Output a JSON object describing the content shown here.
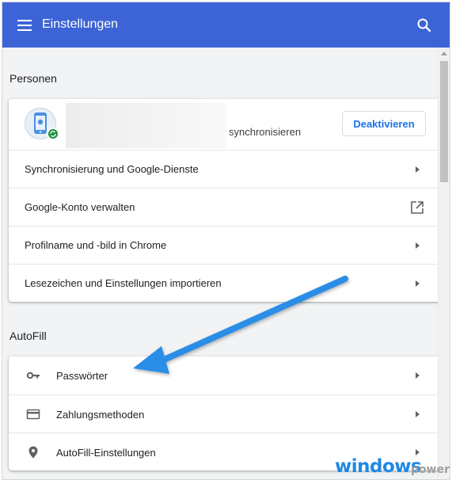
{
  "header": {
    "title": "Einstellungen",
    "menu_icon": "hamburger-menu-icon",
    "search_icon": "search-icon",
    "color": "#3c64d6"
  },
  "people": {
    "section_title": "Personen",
    "account": {
      "sync_text": "synchronisieren",
      "deactivate_label": "Deaktivieren",
      "avatar_icon": "phone-apple-avatar-icon",
      "badge_icon": "sync-icon"
    },
    "rows": [
      {
        "label": "Synchronisierung und Google-Dienste",
        "trailing": "chevron-right-icon"
      },
      {
        "label": "Google-Konto verwalten",
        "trailing": "external-link-icon"
      },
      {
        "label": "Profilname und -bild in Chrome",
        "trailing": "chevron-right-icon"
      },
      {
        "label": "Lesezeichen und Einstellungen importieren",
        "trailing": "chevron-right-icon"
      }
    ]
  },
  "autofill": {
    "section_title": "AutoFill",
    "rows": [
      {
        "label": "Passwörter",
        "icon": "key-icon"
      },
      {
        "label": "Zahlungsmethoden",
        "icon": "credit-card-icon"
      },
      {
        "label": "AutoFill-Einstellungen",
        "icon": "location-pin-icon"
      }
    ]
  },
  "annotation": {
    "arrow_color": "#1e88e5"
  },
  "watermark": {
    "main": "windows",
    "sub": "power"
  }
}
